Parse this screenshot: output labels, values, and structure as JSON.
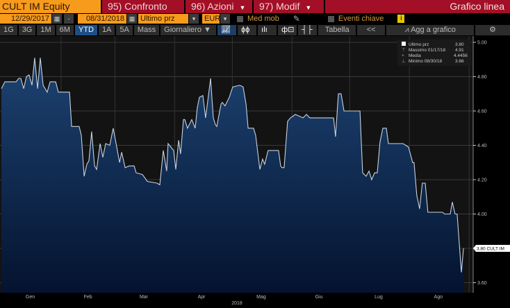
{
  "header": {
    "ticker": "CULT IM Equity",
    "btn_compare": "95) Confronto",
    "btn_actions": "96) Azioni",
    "btn_edit": "97) Modif",
    "title": "Grafico linea"
  },
  "controls": {
    "start_date": "12/29/2017",
    "dash": "-",
    "end_date": "08/31/2018",
    "field": "Ultimo prz",
    "currency": "EUR",
    "moving_avg": "Med mob",
    "key_events": "Eventi chiave",
    "info": "i"
  },
  "toolbar": {
    "ranges": [
      "1G",
      "3G",
      "1M",
      "6M",
      "YTD",
      "1A",
      "5A",
      "Mass"
    ],
    "active_range": "YTD",
    "frequency": "Giornaliero",
    "table": "Tabella",
    "collapse": "<<",
    "add_to_chart": "Agg a grafico"
  },
  "legend": {
    "last_label": "Ultimo prz",
    "last_value": "3.80",
    "max_label": "Massimo 01/17/18",
    "max_value": "4.91",
    "avg_label": "Media",
    "avg_value": "4.4456",
    "min_label": "Minimo 08/30/18",
    "min_value": "3.66"
  },
  "price_tag": "3.80 CULT IM",
  "chart_data": {
    "type": "area",
    "series": [
      {
        "name": "CULT IM Equity - Ultimo prz",
        "x_unit": "day of 2018",
        "points": [
          [
            0,
            4.73
          ],
          [
            1.8,
            4.77
          ],
          [
            7.6,
            4.77
          ],
          [
            9,
            4.79
          ],
          [
            10.1,
            4.79
          ],
          [
            11.6,
            4.73
          ],
          [
            13,
            4.8
          ],
          [
            14.4,
            4.81
          ],
          [
            15.9,
            4.75
          ],
          [
            17.3,
            4.91
          ],
          [
            18.8,
            4.73
          ],
          [
            20.2,
            4.91
          ],
          [
            21.7,
            4.75
          ],
          [
            23.8,
            4.71
          ],
          [
            25.3,
            4.77
          ],
          [
            28.2,
            4.77
          ],
          [
            29.6,
            4.71
          ],
          [
            35.4,
            4.71
          ],
          [
            36.5,
            4.51
          ],
          [
            40.4,
            4.51
          ],
          [
            41.5,
            4.46
          ],
          [
            43,
            4.22
          ],
          [
            44.4,
            4.29
          ],
          [
            45.5,
            4.31
          ],
          [
            46.9,
            4.48
          ],
          [
            48.4,
            4.28
          ],
          [
            49.5,
            4.26
          ],
          [
            51.3,
            4.41
          ],
          [
            52.7,
            4.33
          ],
          [
            54.2,
            4.41
          ],
          [
            56.3,
            4.4
          ],
          [
            58.1,
            4.5
          ],
          [
            59.6,
            4.41
          ],
          [
            61.4,
            4.3
          ],
          [
            62.5,
            4.36
          ],
          [
            64.3,
            4.27
          ],
          [
            66.4,
            4.28
          ],
          [
            69,
            4.28
          ],
          [
            70,
            4.24
          ],
          [
            73.3,
            4.23
          ],
          [
            75.8,
            4.19
          ],
          [
            80.9,
            4.18
          ],
          [
            82.3,
            4.17
          ],
          [
            84.1,
            4.37
          ],
          [
            85.9,
            4.25
          ],
          [
            86.6,
            4.41
          ],
          [
            89.5,
            4.37
          ],
          [
            90.6,
            4.26
          ],
          [
            92.1,
            4.43
          ],
          [
            93.1,
            4.35
          ],
          [
            94.6,
            4.55
          ],
          [
            95.3,
            4.55
          ],
          [
            96.7,
            4.5
          ],
          [
            98.9,
            4.55
          ],
          [
            100.7,
            4.5
          ],
          [
            101.8,
            4.62
          ],
          [
            102.9,
            4.68
          ],
          [
            104.7,
            4.69
          ],
          [
            106.1,
            4.56
          ],
          [
            108.7,
            4.79
          ],
          [
            110.1,
            4.56
          ],
          [
            111.2,
            4.52
          ],
          [
            111.9,
            4.51
          ],
          [
            114.1,
            4.64
          ],
          [
            114.8,
            4.65
          ],
          [
            116.2,
            4.63
          ],
          [
            118.4,
            4.68
          ],
          [
            120.2,
            4.74
          ],
          [
            123.8,
            4.75
          ],
          [
            125.6,
            4.74
          ],
          [
            127.1,
            4.64
          ],
          [
            128.2,
            4.5
          ],
          [
            131,
            4.5
          ],
          [
            132.1,
            4.46
          ],
          [
            134.3,
            4.26
          ],
          [
            135.7,
            4.32
          ],
          [
            136.8,
            4.29
          ],
          [
            138.6,
            4.37
          ],
          [
            144,
            4.37
          ],
          [
            145.1,
            4.28
          ],
          [
            145.8,
            4.27
          ],
          [
            146.9,
            4.27
          ],
          [
            148.7,
            4.54
          ],
          [
            150.2,
            4.56
          ],
          [
            152.7,
            4.58
          ],
          [
            156.7,
            4.56
          ],
          [
            158.5,
            4.58
          ],
          [
            160.3,
            4.56
          ],
          [
            172.6,
            4.56
          ],
          [
            173.6,
            4.45
          ],
          [
            175.1,
            4.7
          ],
          [
            176.5,
            4.7
          ],
          [
            178,
            4.6
          ],
          [
            186.3,
            4.6
          ],
          [
            187.7,
            4.24
          ],
          [
            189.5,
            4.22
          ],
          [
            191,
            4.25
          ],
          [
            192.4,
            4.2
          ],
          [
            193.9,
            4.24
          ],
          [
            195.3,
            4.24
          ],
          [
            196.7,
            4.42
          ],
          [
            198.2,
            4.5
          ],
          [
            200,
            4.5
          ],
          [
            201.1,
            4.41
          ],
          [
            208.7,
            4.41
          ],
          [
            211.5,
            4.39
          ],
          [
            213.7,
            4.3
          ],
          [
            214.4,
            4.3
          ],
          [
            215.8,
            4.11
          ],
          [
            217.3,
            4.03
          ],
          [
            218.7,
            4.18
          ],
          [
            220.2,
            4.18
          ],
          [
            221.6,
            4.01
          ],
          [
            229.2,
            4.01
          ],
          [
            230.3,
            4.0
          ],
          [
            233.2,
            4.0
          ],
          [
            234.3,
            4.07
          ],
          [
            235.7,
            4.0
          ],
          [
            236.8,
            4.0
          ],
          [
            239,
            3.66
          ],
          [
            240.1,
            3.8
          ]
        ]
      }
    ],
    "x_months": [
      {
        "label": "Gen",
        "mid": 15
      },
      {
        "label": "Feb",
        "mid": 45
      },
      {
        "label": "Mar",
        "mid": 74
      },
      {
        "label": "Apr",
        "mid": 104
      },
      {
        "label": "Mag",
        "mid": 135
      },
      {
        "label": "Giu",
        "mid": 165
      },
      {
        "label": "Lug",
        "mid": 196
      },
      {
        "label": "Ago",
        "mid": 227
      }
    ],
    "month_boundaries": [
      31,
      59,
      90,
      120,
      151,
      181,
      212,
      243
    ],
    "xlabel": "2018",
    "y_ticks": [
      "5.00",
      "4.80",
      "4.60",
      "4.40",
      "4.20",
      "4.00",
      "3.80",
      "3.60"
    ],
    "ylim": [
      3.55,
      5.05
    ],
    "xlim": [
      0,
      243
    ],
    "grid": true,
    "legend": "top-right"
  }
}
